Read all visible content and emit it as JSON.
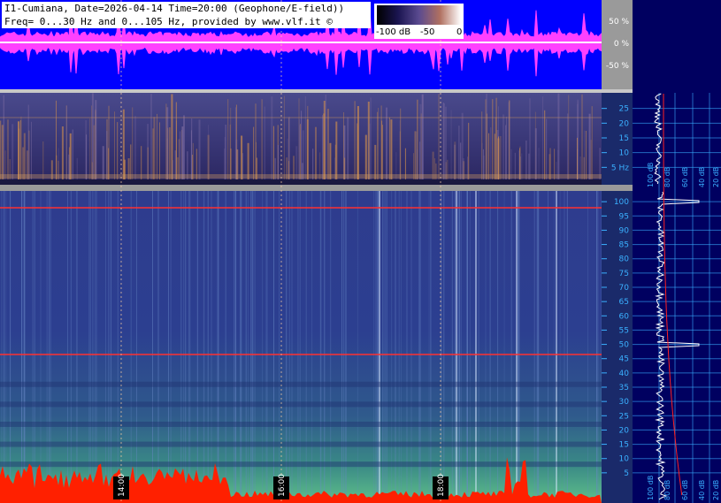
{
  "header": {
    "title_line1": "I1-Cumiana, Date=2026-04-14 Time=20:00 (Geophone/E-field))",
    "title_line2": "Freq= 0...30 Hz and 0...105 Hz, provided by www.vlf.it ©"
  },
  "colorbar": {
    "labels": [
      "-100 dB",
      "-50",
      "0"
    ],
    "stops": [
      "#000000",
      "#1a1450",
      "#5a4a90",
      "#b07060",
      "#ffffff"
    ]
  },
  "colors": {
    "waveform_bg": "#0000ff",
    "waveform": "#ff40ff",
    "spectrogram_bg": "#2a3a8c",
    "low_band": "#ff2000",
    "gridline": "#3ab0ff",
    "axis_text": "#3ab0ff",
    "spectrum_trace": "#ffffff",
    "spectrum_fit": "#ff2020"
  },
  "chart_data": [
    {
      "type": "line",
      "name": "waveform",
      "y_ticks": [
        "50 %",
        "0 %",
        "-50 %"
      ],
      "y_tick_values": [
        50,
        0,
        -50
      ],
      "ylim": [
        -100,
        100
      ]
    },
    {
      "type": "heatmap",
      "name": "spectrogram-0-30",
      "y_ticks": [
        "25",
        "20",
        "15",
        "10",
        "5 Hz"
      ],
      "y_tick_values": [
        25,
        20,
        15,
        10,
        5
      ],
      "ylim": [
        0,
        30
      ]
    },
    {
      "type": "heatmap",
      "name": "spectrogram-0-105",
      "y_ticks": [
        "100",
        "95",
        "90",
        "85",
        "80",
        "75",
        "70",
        "65",
        "60",
        "55",
        "50",
        "45",
        "40",
        "35",
        "30",
        "25",
        "20",
        "15",
        "10",
        "5"
      ],
      "y_tick_values": [
        100,
        95,
        90,
        85,
        80,
        75,
        70,
        65,
        60,
        55,
        50,
        45,
        40,
        35,
        30,
        25,
        20,
        15,
        10,
        5
      ],
      "ylim": [
        0,
        105
      ],
      "time_labels": [
        "14:00",
        "16:00",
        "18:00"
      ],
      "line_frequencies_hz": [
        50,
        100
      ]
    },
    {
      "type": "line",
      "name": "average-spectrum",
      "x_ticks": [
        "100 dB",
        "80 dB",
        "60 dB",
        "40 dB",
        "20 dB"
      ],
      "peaks_hz": [
        50,
        100
      ]
    }
  ]
}
